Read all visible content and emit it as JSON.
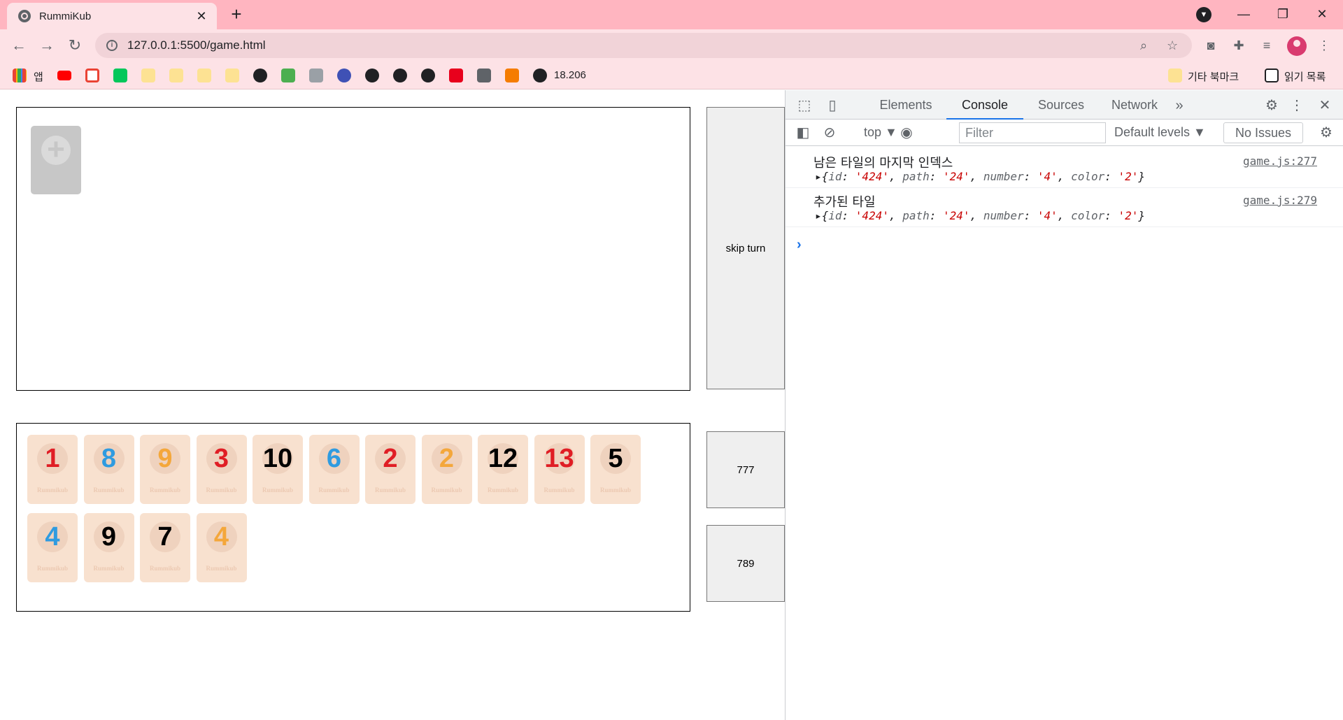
{
  "browser": {
    "tab_title": "RummiKub",
    "tab_close": "✕",
    "new_tab": "+",
    "url": "127.0.0.1:5500/game.html",
    "minimize": "—",
    "maximize": "❐",
    "close": "✕"
  },
  "bookmarks": {
    "apps_label": "앱",
    "ip_label": "18.206",
    "other_label": "기타 북마크",
    "reading_list_label": "읽기 목록"
  },
  "game": {
    "skip_label": "skip turn",
    "counter_a": "777",
    "counter_b": "789",
    "tile_brand": "Rummikub",
    "tiles_row1": [
      {
        "number": "1",
        "color": "red"
      },
      {
        "number": "8",
        "color": "blue"
      },
      {
        "number": "9",
        "color": "orange"
      },
      {
        "number": "3",
        "color": "red"
      },
      {
        "number": "10",
        "color": "black"
      },
      {
        "number": "6",
        "color": "blue"
      },
      {
        "number": "2",
        "color": "red"
      },
      {
        "number": "2",
        "color": "orange"
      },
      {
        "number": "12",
        "color": "black"
      },
      {
        "number": "13",
        "color": "red"
      },
      {
        "number": "5",
        "color": "black"
      }
    ],
    "tiles_row2": [
      {
        "number": "4",
        "color": "blue"
      },
      {
        "number": "9",
        "color": "black"
      },
      {
        "number": "7",
        "color": "black"
      },
      {
        "number": "4",
        "color": "orange"
      }
    ]
  },
  "devtools": {
    "tabs": [
      "Elements",
      "Console",
      "Sources",
      "Network"
    ],
    "context": "top ▼",
    "filter_placeholder": "Filter",
    "levels": "Default levels ▼",
    "issues": "No Issues",
    "logs": [
      {
        "message": "남은 타일의 마지막 인덱스",
        "source": "game.js:277",
        "object": {
          "id": "'424'",
          "path": "'24'",
          "number": "'4'",
          "color": "'2'"
        }
      },
      {
        "message": "추가된 타일",
        "source": "game.js:279",
        "object": {
          "id": "'424'",
          "path": "'24'",
          "number": "'4'",
          "color": "'2'"
        }
      }
    ]
  },
  "colors": {
    "red": "#e01e25",
    "blue": "#2f9be0",
    "orange": "#f4a73b",
    "black": "#000000",
    "chrome_frame": "#ffb5c0"
  }
}
